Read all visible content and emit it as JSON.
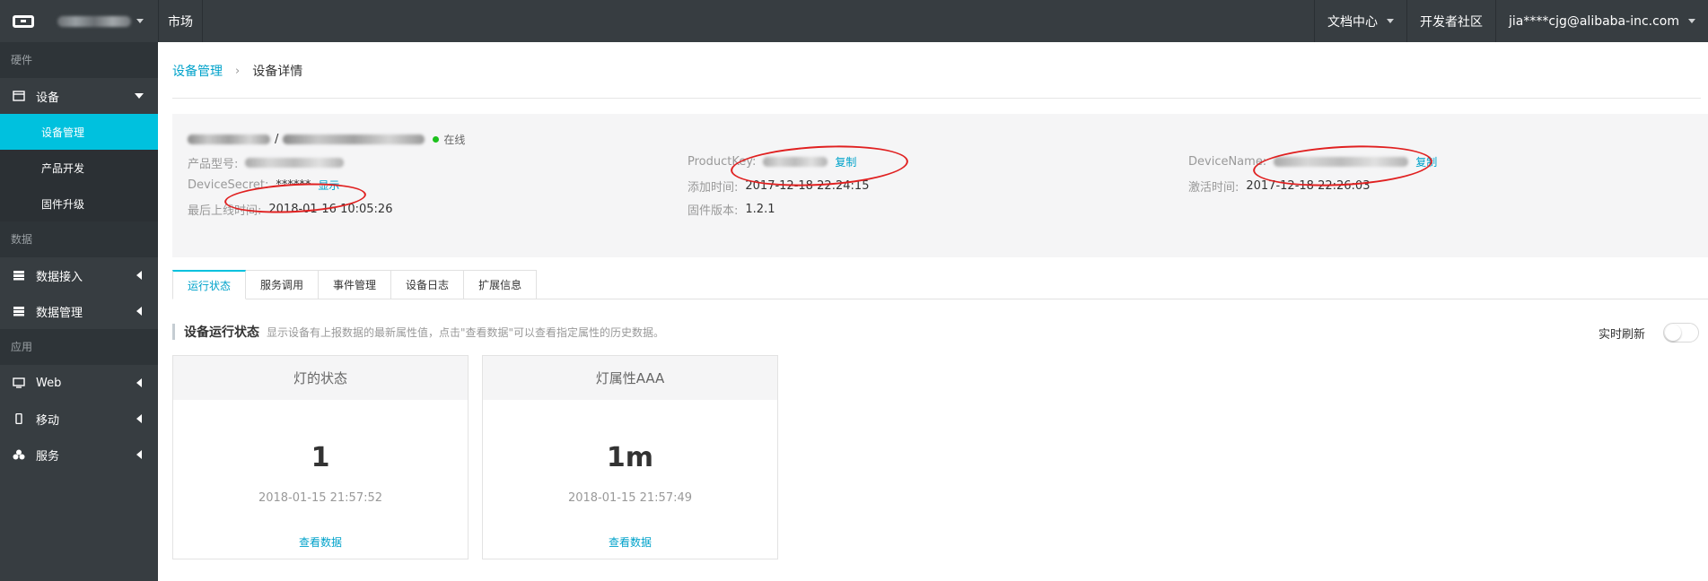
{
  "topbar": {
    "market": "市场",
    "docs": "文档中心",
    "community": "开发者社区",
    "user": "jia****cjg@alibaba-inc.com"
  },
  "sidebar": {
    "section_hardware": "硬件",
    "device": "设备",
    "device_manage": "设备管理",
    "product_dev": "产品开发",
    "firmware": "固件升级",
    "section_data": "数据",
    "data_access": "数据接入",
    "data_manage": "数据管理",
    "section_app": "应用",
    "web": "Web",
    "mobile": "移动",
    "service": "服务"
  },
  "breadcrumb": {
    "parent": "设备管理",
    "separator": "›",
    "current": "设备详情"
  },
  "device": {
    "title_sep": "/",
    "status": "在线",
    "model_label": "产品型号:",
    "secret_label": "DeviceSecret:",
    "secret_value": "******",
    "secret_action": "显示",
    "last_online_label": "最后上线时间:",
    "last_online_value": "2018-01-16 10:05:26",
    "productkey_label": "ProductKey:",
    "productkey_action": "复制",
    "added_label": "添加时间:",
    "added_value": "2017-12-18 22:24:15",
    "firmware_label": "固件版本:",
    "firmware_value": "1.2.1",
    "devicename_label": "DeviceName:",
    "devicename_action": "复制",
    "activated_label": "激活时间:",
    "activated_value": "2017-12-18 22:26:03"
  },
  "tabs": [
    "运行状态",
    "服务调用",
    "事件管理",
    "设备日志",
    "扩展信息"
  ],
  "section": {
    "title": "设备运行状态",
    "desc": "显示设备有上报数据的最新属性值，点击\"查看数据\"可以查看指定属性的历史数据。",
    "refresh_label": "实时刷新"
  },
  "cards": [
    {
      "name": "灯的状态",
      "value": "1",
      "time": "2018-01-15 21:57:52",
      "link": "查看数据"
    },
    {
      "name": "灯属性AAA",
      "value": "1m",
      "time": "2018-01-15 21:57:49",
      "link": "查看数据"
    }
  ],
  "colors": {
    "topbar": "#373d41",
    "accent": "#00c1de",
    "link": "#00a2ca",
    "annotation": "#e02020",
    "online": "#1dc11d"
  }
}
